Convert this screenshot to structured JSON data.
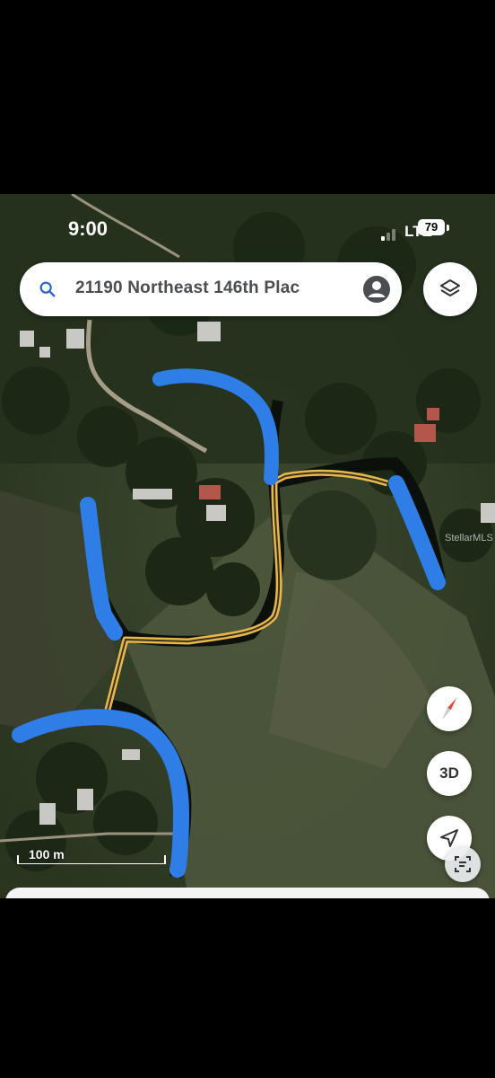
{
  "status_bar": {
    "time": "9:00",
    "network": "LTE",
    "battery": "79"
  },
  "search": {
    "text": "21190 Northeast 146th Plac"
  },
  "buttons": {
    "three_d": "3D"
  },
  "scale": {
    "label": "100 m"
  },
  "watermark": "StellarMLS",
  "icons": {
    "search": "search-icon",
    "account": "account-circle-icon",
    "layers": "layers-icon",
    "compass": "compass-icon",
    "locate": "navigation-arrow-icon",
    "scan": "scan-text-icon"
  },
  "colors": {
    "annotation_blue": "#2f7de6",
    "path_yellow": "#e9b84a"
  }
}
